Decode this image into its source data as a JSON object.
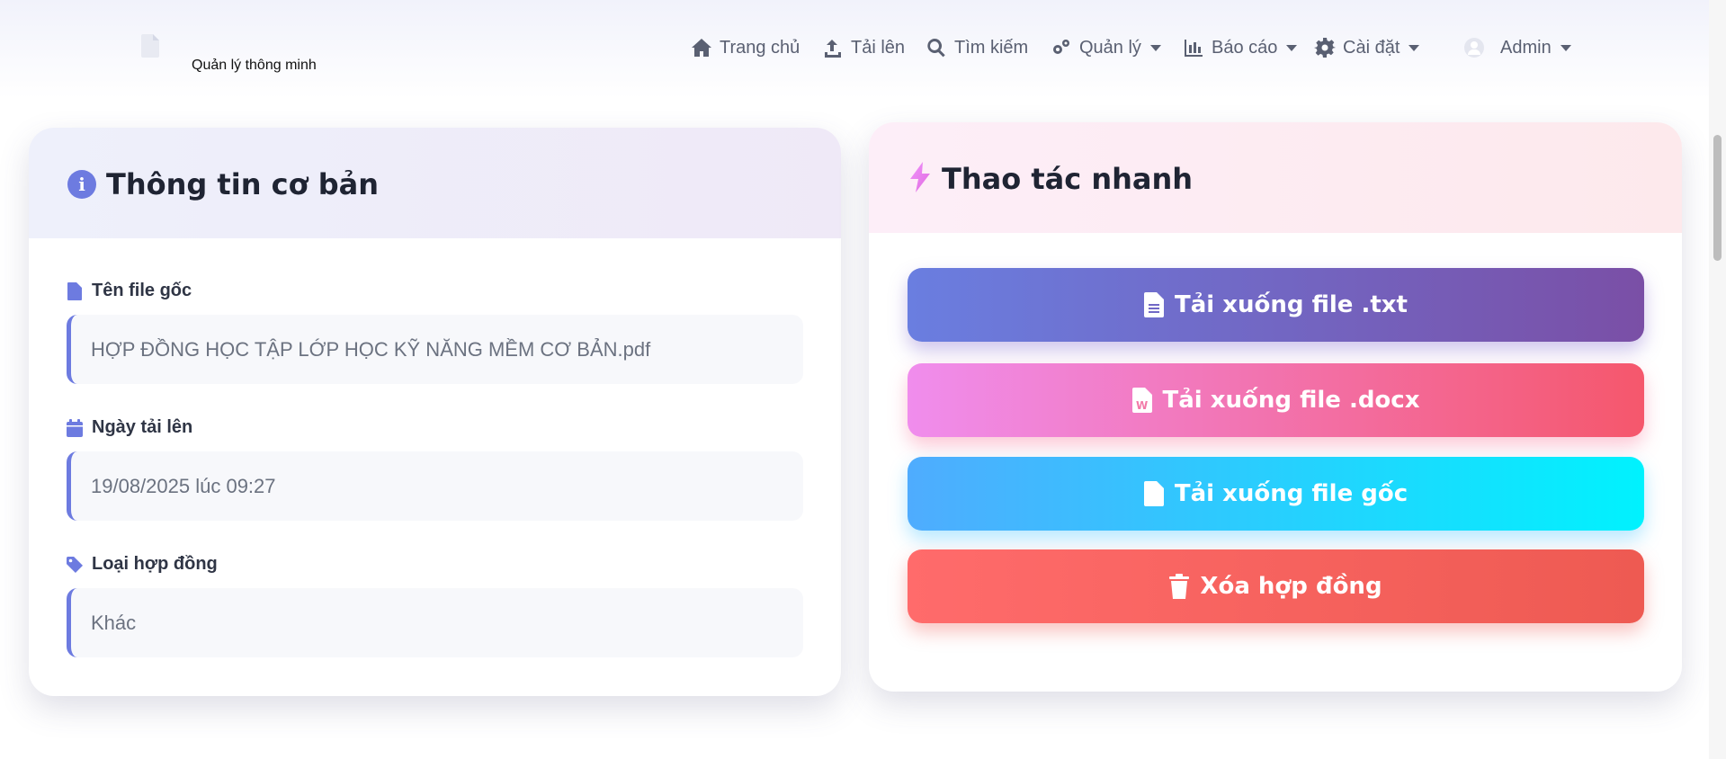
{
  "brand": {
    "name": "Quản lý thông minh",
    "icon": "file-icon"
  },
  "nav": {
    "home": "Trang chủ",
    "upload": "Tải lên",
    "search": "Tìm kiếm",
    "manage": "Quản lý",
    "reports": "Báo cáo",
    "settings": "Cài đặt",
    "user": "Admin"
  },
  "basic_info": {
    "title": "Thông tin cơ bản",
    "fields": [
      {
        "label": "Tên file gốc",
        "value": "HỢP ĐỒNG HỌC TẬP LỚP HỌC KỸ NĂNG MỀM CƠ BẢN.pdf",
        "icon": "file-icon"
      },
      {
        "label": "Ngày tải lên",
        "value": "19/08/2025 lúc 09:27",
        "icon": "calendar-icon"
      },
      {
        "label": "Loại hợp đồng",
        "value": "Khác",
        "icon": "tag-icon"
      }
    ]
  },
  "quick_actions": {
    "title": "Thao tác nhanh",
    "buttons": [
      {
        "label": "Tải xuống file .txt",
        "icon": "file-text-icon"
      },
      {
        "label": "Tải xuống file .docx",
        "icon": "file-word-icon"
      },
      {
        "label": "Tải xuống file gốc",
        "icon": "file-icon"
      },
      {
        "label": "Xóa hợp đồng",
        "icon": "trash-icon"
      }
    ]
  },
  "colors": {
    "accent": "#6d7be0",
    "txt_gradient": [
      "#6a7ee0",
      "#7a4fa6"
    ],
    "docx_gradient": [
      "#f08ded",
      "#f5576c"
    ],
    "original_gradient": [
      "#4facfe",
      "#00f2fe"
    ],
    "delete_gradient": [
      "#ff6b6b",
      "#ee5a52"
    ]
  }
}
